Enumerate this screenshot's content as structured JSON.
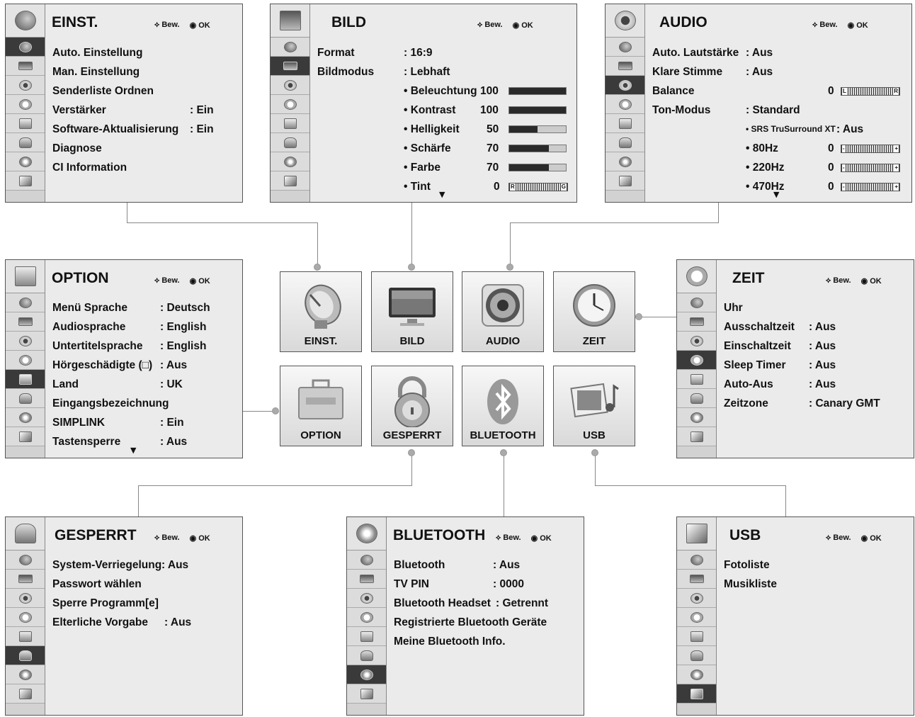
{
  "hint": {
    "move": "Bew.",
    "ok": "OK"
  },
  "tiles": [
    {
      "label": "EINST."
    },
    {
      "label": "BILD"
    },
    {
      "label": "AUDIO"
    },
    {
      "label": "ZEIT"
    },
    {
      "label": "OPTION"
    },
    {
      "label": "GESPERRT"
    },
    {
      "label": "BLUETOOTH"
    },
    {
      "label": "USB"
    }
  ],
  "einst": {
    "title": "EINST.",
    "rows": [
      {
        "k": "Auto. Einstellung",
        "v": ""
      },
      {
        "k": "Man. Einstellung",
        "v": ""
      },
      {
        "k": "Senderliste Ordnen",
        "v": ""
      },
      {
        "k": "Verstärker",
        "v": ": Ein"
      },
      {
        "k": "Software-Aktualisierung",
        "v": ": Ein"
      },
      {
        "k": "Diagnose",
        "v": ""
      },
      {
        "k": "CI Information",
        "v": ""
      }
    ]
  },
  "bild": {
    "title": "BILD",
    "format_k": "Format",
    "format_v": ": 16:9",
    "modus_k": "Bildmodus",
    "modus_v": ": Lebhaft",
    "rows": [
      {
        "k": "• Beleuchtung",
        "v": "100",
        "level": 100
      },
      {
        "k": "• Kontrast",
        "v": "100",
        "level": 100
      },
      {
        "k": "• Helligkeit",
        "v": "50",
        "level": 50
      },
      {
        "k": "• Schärfe",
        "v": "70",
        "level": 70
      },
      {
        "k": "• Farbe",
        "v": "70",
        "level": 70
      },
      {
        "k": "• Tint",
        "v": "0",
        "left": "R",
        "right": "G"
      }
    ]
  },
  "audio": {
    "title": "AUDIO",
    "rows": [
      {
        "k": "Auto. Lautstärke",
        "v": ": Aus"
      },
      {
        "k": "Klare Stimme",
        "v": ": Aus"
      },
      {
        "k": "Balance",
        "v": "0",
        "left": "L",
        "right": "R"
      },
      {
        "k": "Ton-Modus",
        "v": ": Standard"
      }
    ],
    "sub": [
      {
        "k": "• SRS TruSurround XT",
        "v": ": Aus"
      },
      {
        "k": "• 80Hz",
        "v": "0",
        "left": "-",
        "right": "+"
      },
      {
        "k": "• 220Hz",
        "v": "0",
        "left": "-",
        "right": "+"
      },
      {
        "k": "• 470Hz",
        "v": "0",
        "left": "-",
        "right": "+"
      }
    ]
  },
  "option": {
    "title": "OPTION",
    "rows": [
      {
        "k": "Menü Sprache",
        "v": ": Deutsch"
      },
      {
        "k": "Audiosprache",
        "v": ": English"
      },
      {
        "k": "Untertitelsprache",
        "v": ": English"
      },
      {
        "k": "Hörgeschädigte (□)",
        "v": ": Aus"
      },
      {
        "k": "Land",
        "v": ": UK"
      },
      {
        "k": "Eingangsbezeichnung",
        "v": ""
      },
      {
        "k": "SIMPLINK",
        "v": ": Ein"
      },
      {
        "k": "Tastensperre",
        "v": ": Aus"
      }
    ]
  },
  "zeit": {
    "title": "ZEIT",
    "rows": [
      {
        "k": "Uhr",
        "v": ""
      },
      {
        "k": "Ausschaltzeit",
        "v": ": Aus"
      },
      {
        "k": "Einschaltzeit",
        "v": ": Aus"
      },
      {
        "k": "Sleep Timer",
        "v": ": Aus"
      },
      {
        "k": "Auto-Aus",
        "v": ": Aus"
      },
      {
        "k": "Zeitzone",
        "v": ": Canary GMT"
      }
    ]
  },
  "gesperrt": {
    "title": "GESPERRT",
    "rows": [
      {
        "k": "System-Verriegelung",
        "v": ": Aus"
      },
      {
        "k": "Passwort wählen",
        "v": ""
      },
      {
        "k": "Sperre Programm[e]",
        "v": ""
      },
      {
        "k": "Elterliche Vorgabe",
        "v": ": Aus"
      }
    ]
  },
  "bluetooth": {
    "title": "BLUETOOTH",
    "rows": [
      {
        "k": "Bluetooth",
        "v": ": Aus"
      },
      {
        "k": "TV PIN",
        "v": ": 0000"
      },
      {
        "k": "Bluetooth Headset",
        "v": ": Getrennt"
      },
      {
        "k": "Registrierte Bluetooth Geräte",
        "v": ""
      },
      {
        "k": "Meine Bluetooth Info.",
        "v": ""
      }
    ]
  },
  "usb": {
    "title": "USB",
    "rows": [
      {
        "k": "Fotoliste",
        "v": ""
      },
      {
        "k": "Musikliste",
        "v": ""
      }
    ]
  },
  "arrow": "▼"
}
